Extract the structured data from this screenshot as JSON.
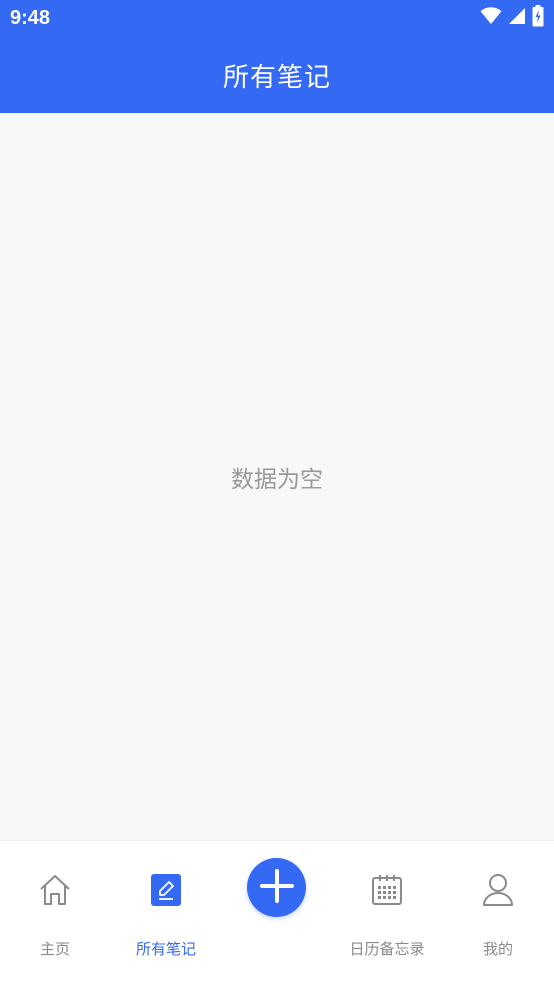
{
  "status_bar": {
    "time": "9:48",
    "icons": [
      "wifi-icon",
      "signal-icon",
      "battery-charging-icon"
    ]
  },
  "header": {
    "title": "所有笔记"
  },
  "main": {
    "empty_message": "数据为空"
  },
  "bottom_nav": {
    "active_index": 1,
    "items": [
      {
        "label": "主页",
        "icon": "home-icon"
      },
      {
        "label": "所有笔记",
        "icon": "edit-note-icon"
      },
      {
        "label": "",
        "icon": "add-icon"
      },
      {
        "label": "日历备忘录",
        "icon": "calendar-icon"
      },
      {
        "label": "我的",
        "icon": "user-icon"
      }
    ]
  },
  "colors": {
    "primary": "#3369f3",
    "background": "#f7f8fa",
    "muted_text": "#999999",
    "nav_inactive": "#8a8a8a"
  }
}
